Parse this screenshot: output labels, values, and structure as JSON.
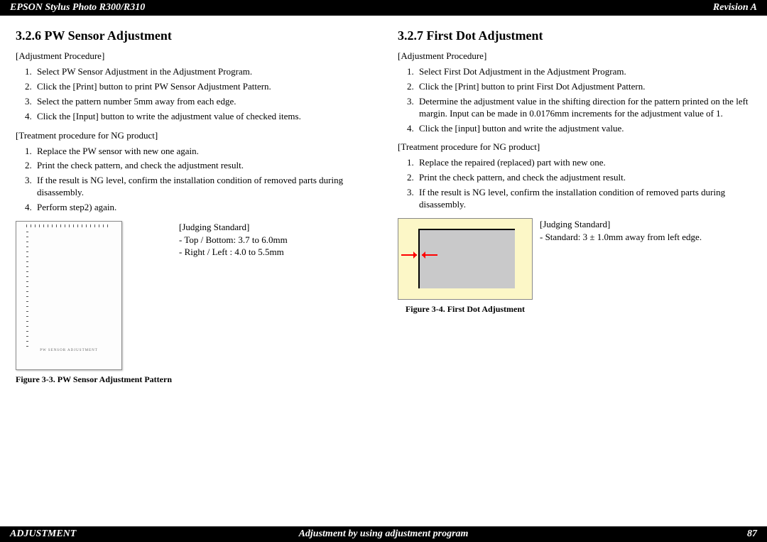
{
  "header": {
    "left": "EPSON Stylus Photo R300/R310",
    "right": "Revision A"
  },
  "footer": {
    "left": "ADJUSTMENT",
    "center": "Adjustment by using adjustment program",
    "right": "87"
  },
  "left": {
    "heading": "3.2.6  PW Sensor Adjustment",
    "proc_label": "[Adjustment Procedure]",
    "proc": [
      "Select PW Sensor Adjustment in the Adjustment Program.",
      "Click the [Print] button to print PW Sensor Adjustment Pattern.",
      "Select the pattern number 5mm away from each edge.",
      "Click the [Input] button to write the adjustment value of checked items."
    ],
    "ng_label": "[Treatment procedure for NG product]",
    "ng": [
      "Replace the PW sensor with new one again.",
      "Print the check pattern, and check the adjustment result.",
      "If the result is NG level, confirm the installation condition of removed parts during disassembly.",
      "Perform step2) again."
    ],
    "judging_label": "[Judging Standard]",
    "judge1": "- Top / Bottom: 3.7 to 6.0mm",
    "judge2": "- Right / Left   : 4.0 to 5.5mm",
    "pattern_text": "PW SENSOR ADJUSTMENT",
    "figcap": "Figure 3-3. PW Sensor Adjustment Pattern"
  },
  "right": {
    "heading": "3.2.7  First Dot Adjustment",
    "proc_label": "[Adjustment Procedure]",
    "proc": [
      "Select First Dot Adjustment in the Adjustment Program.",
      "Click the [Print] button to print First Dot Adjustment Pattern.",
      "Determine the adjustment value in the shifting direction for the pattern printed on the left margin. Input can be made in 0.0176mm increments for the adjustment value of 1.",
      "Click the [input] button and write the adjustment value."
    ],
    "ng_label": "[Treatment procedure for NG product]",
    "ng": [
      "Replace the repaired (replaced) part with new one.",
      "Print the check pattern, and check the adjustment result.",
      "If the result is NG level, confirm the installation condition of removed parts during disassembly."
    ],
    "judging_label": "[Judging Standard]",
    "judge1": "- Standard: 3 ± 1.0mm away from left edge.",
    "figcap": "Figure 3-4. First Dot Adjustment"
  }
}
